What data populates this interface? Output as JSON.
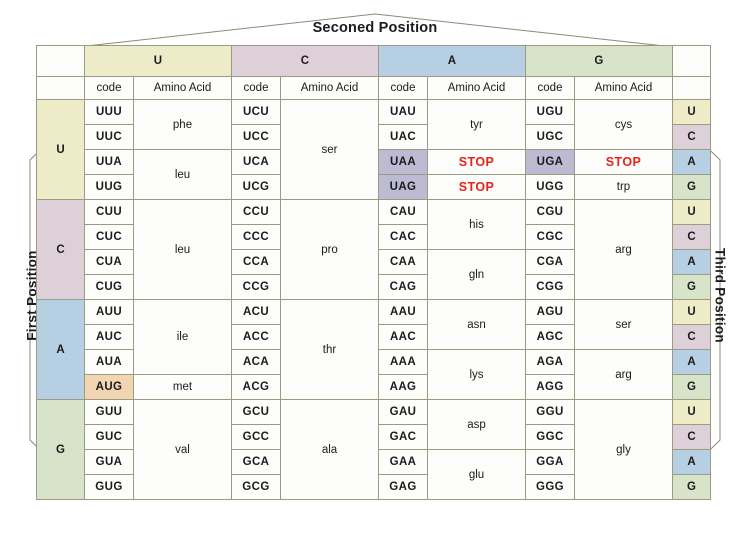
{
  "titles": {
    "second_position": "Seconed Position",
    "first_position": "First Position",
    "third_position": "Third Position"
  },
  "column_headers": {
    "bases": [
      "U",
      "C",
      "A",
      "G"
    ],
    "code_label": "code",
    "amino_acid_label": "Amino Acid"
  },
  "colors": {
    "U": "#edebc8",
    "C": "#ded0d8",
    "A": "#b6cfe3",
    "G": "#d7e4ca",
    "stop_fill": "#bdbbd3",
    "start_fill": "#f2d6b3",
    "stop_text": "#e8231a",
    "border": "#9a9b80",
    "text": "#1b1b1b"
  },
  "special": {
    "stop_label": "STOP",
    "stop_codons": [
      "UAA",
      "UAG",
      "UGA"
    ],
    "start_codon": "AUG"
  },
  "third_position_sequence": [
    "U",
    "C",
    "A",
    "G"
  ],
  "chart_data": {
    "type": "table",
    "title": "Genetic Code Table (RNA codons to amino acids)",
    "row_blocks": [
      {
        "first_base": "U",
        "rows": [
          {
            "third": "U",
            "cells": [
              {
                "codon": "UUU",
                "aa": "phe",
                "span": 2
              },
              {
                "codon": "UCU",
                "aa": "ser",
                "span": 4
              },
              {
                "codon": "UAU",
                "aa": "tyr",
                "span": 2
              },
              {
                "codon": "UGU",
                "aa": "cys",
                "span": 2
              }
            ]
          },
          {
            "third": "C",
            "cells": [
              {
                "codon": "UUC"
              },
              {
                "codon": "UCC"
              },
              {
                "codon": "UAC"
              },
              {
                "codon": "UGC"
              }
            ]
          },
          {
            "third": "A",
            "cells": [
              {
                "codon": "UUA",
                "aa": "leu",
                "span": 2
              },
              {
                "codon": "UCA"
              },
              {
                "codon": "UAA",
                "aa": "STOP",
                "span": 1,
                "stop": true
              },
              {
                "codon": "UGA",
                "aa": "STOP",
                "span": 1,
                "stop": true
              }
            ]
          },
          {
            "third": "G",
            "cells": [
              {
                "codon": "UUG"
              },
              {
                "codon": "UCG"
              },
              {
                "codon": "UAG",
                "aa": "STOP",
                "span": 1,
                "stop": true
              },
              {
                "codon": "UGG",
                "aa": "trp",
                "span": 1
              }
            ]
          }
        ]
      },
      {
        "first_base": "C",
        "rows": [
          {
            "third": "U",
            "cells": [
              {
                "codon": "CUU",
                "aa": "leu",
                "span": 4
              },
              {
                "codon": "CCU",
                "aa": "pro",
                "span": 4
              },
              {
                "codon": "CAU",
                "aa": "his",
                "span": 2
              },
              {
                "codon": "CGU",
                "aa": "arg",
                "span": 4
              }
            ]
          },
          {
            "third": "C",
            "cells": [
              {
                "codon": "CUC"
              },
              {
                "codon": "CCC"
              },
              {
                "codon": "CAC"
              },
              {
                "codon": "CGC"
              }
            ]
          },
          {
            "third": "A",
            "cells": [
              {
                "codon": "CUA"
              },
              {
                "codon": "CCA"
              },
              {
                "codon": "CAA",
                "aa": "gln",
                "span": 2
              },
              {
                "codon": "CGA"
              }
            ]
          },
          {
            "third": "G",
            "cells": [
              {
                "codon": "CUG"
              },
              {
                "codon": "CCG"
              },
              {
                "codon": "CAG"
              },
              {
                "codon": "CGG"
              }
            ]
          }
        ]
      },
      {
        "first_base": "A",
        "rows": [
          {
            "third": "U",
            "cells": [
              {
                "codon": "AUU",
                "aa": "ile",
                "span": 3
              },
              {
                "codon": "ACU",
                "aa": "thr",
                "span": 4
              },
              {
                "codon": "AAU",
                "aa": "asn",
                "span": 2
              },
              {
                "codon": "AGU",
                "aa": "ser",
                "span": 2
              }
            ]
          },
          {
            "third": "C",
            "cells": [
              {
                "codon": "AUC"
              },
              {
                "codon": "ACC"
              },
              {
                "codon": "AAC"
              },
              {
                "codon": "AGC"
              }
            ]
          },
          {
            "third": "A",
            "cells": [
              {
                "codon": "AUA"
              },
              {
                "codon": "ACA"
              },
              {
                "codon": "AAA",
                "aa": "lys",
                "span": 2
              },
              {
                "codon": "AGA",
                "aa": "arg",
                "span": 2
              }
            ]
          },
          {
            "third": "G",
            "cells": [
              {
                "codon": "AUG",
                "aa": "met",
                "span": 1,
                "start": true
              },
              {
                "codon": "ACG"
              },
              {
                "codon": "AAG"
              },
              {
                "codon": "AGG"
              }
            ]
          }
        ]
      },
      {
        "first_base": "G",
        "rows": [
          {
            "third": "U",
            "cells": [
              {
                "codon": "GUU",
                "aa": "val",
                "span": 4
              },
              {
                "codon": "GCU",
                "aa": "ala",
                "span": 4
              },
              {
                "codon": "GAU",
                "aa": "asp",
                "span": 2
              },
              {
                "codon": "GGU",
                "aa": "gly",
                "span": 4
              }
            ]
          },
          {
            "third": "C",
            "cells": [
              {
                "codon": "GUC"
              },
              {
                "codon": "GCC"
              },
              {
                "codon": "GAC"
              },
              {
                "codon": "GGC"
              }
            ]
          },
          {
            "third": "A",
            "cells": [
              {
                "codon": "GUA"
              },
              {
                "codon": "GCA"
              },
              {
                "codon": "GAA",
                "aa": "glu",
                "span": 2
              },
              {
                "codon": "GGA"
              }
            ]
          },
          {
            "third": "G",
            "cells": [
              {
                "codon": "GUG"
              },
              {
                "codon": "GCG"
              },
              {
                "codon": "GAG"
              },
              {
                "codon": "GGG"
              }
            ]
          }
        ]
      }
    ]
  }
}
